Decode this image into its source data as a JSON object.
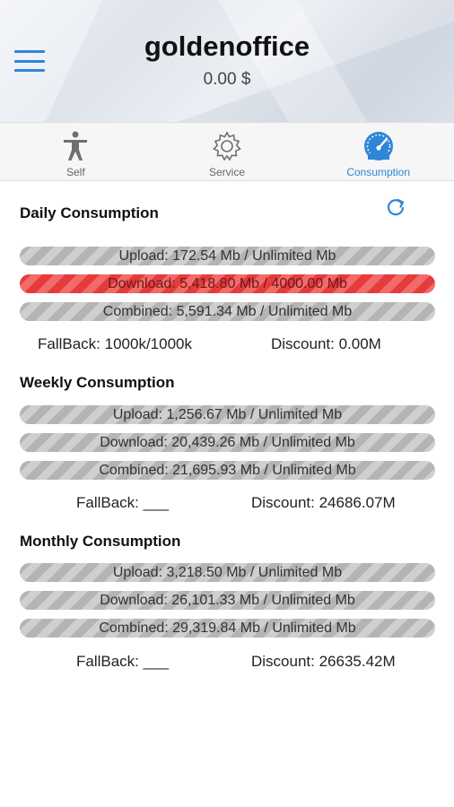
{
  "header": {
    "title": "goldenoffice",
    "balance": "0.00  $"
  },
  "tabs": [
    {
      "label": "Self",
      "icon": "person-icon",
      "active": false
    },
    {
      "label": "Service",
      "icon": "gear-icon",
      "active": false
    },
    {
      "label": "Consumption",
      "icon": "speedometer-icon",
      "active": true
    }
  ],
  "daily": {
    "title": "Daily Consumption",
    "upload": "Upload: 172.54 Mb / Unlimited Mb",
    "download": "Download: 5,418.80 Mb / 4000.00 Mb",
    "combined": "Combined: 5,591.34 Mb / Unlimited Mb",
    "fallback": "FallBack: 1000k/1000k",
    "discount": "Discount: 0.00M"
  },
  "weekly": {
    "title": "Weekly Consumption",
    "upload": "Upload: 1,256.67 Mb / Unlimited Mb",
    "download": "Download: 20,439.26 Mb / Unlimited Mb",
    "combined": "Combined: 21,695.93 Mb / Unlimited Mb",
    "fallback": "FallBack: ___",
    "discount": "Discount: 24686.07M"
  },
  "monthly": {
    "title": "Monthly Consumption",
    "upload": "Upload: 3,218.50 Mb / Unlimited Mb",
    "download": "Download: 26,101.33 Mb / Unlimited Mb",
    "combined": "Combined: 29,319.84 Mb / Unlimited Mb",
    "fallback": "FallBack: ___",
    "discount": "Discount: 26635.42M"
  },
  "colors": {
    "accent": "#2f86d6",
    "over_quota": "#e53b3b",
    "bar_gray": "#b4b4b4"
  }
}
